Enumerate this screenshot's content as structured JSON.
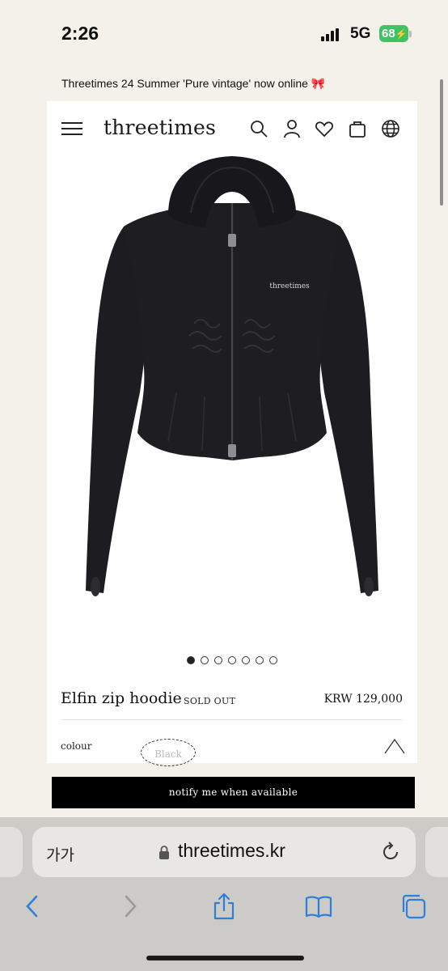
{
  "status_bar": {
    "time": "2:26",
    "network": "5G",
    "battery": "68"
  },
  "announcement": {
    "text": "Threetimes 24 Summer 'Pure vintage' now online",
    "emoji": "🎀"
  },
  "header": {
    "brand": "threetimes",
    "icons": [
      "menu-icon",
      "search-icon",
      "account-icon",
      "wishlist-heart-icon",
      "shopping-bag-icon",
      "language-globe-icon"
    ]
  },
  "product": {
    "image_label": "threetimes",
    "name": "Elfin zip hoodie",
    "status": "SOLD OUT",
    "price": "KRW 129,000",
    "colour_label": "colour",
    "colour_option": "Black"
  },
  "carousel": {
    "total": 7,
    "active_index": 0
  },
  "cta": {
    "notify_label": "notify me when available"
  },
  "browser": {
    "text_size_label": "가가",
    "url": "threetimes.kr",
    "icons": [
      "lock-icon",
      "reload-icon",
      "back-icon",
      "forward-icon",
      "share-icon",
      "bookmarks-icon",
      "tabs-icon"
    ]
  },
  "colors": {
    "page_background": "#f4f0ea",
    "cta_background": "#000000",
    "battery_green": "#3ec262",
    "ios_blue": "#2f7fd8"
  }
}
